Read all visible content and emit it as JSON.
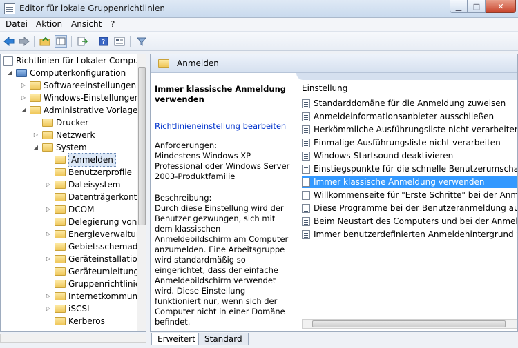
{
  "window": {
    "title": "Editor für lokale Gruppenrichtlinien"
  },
  "menu": [
    "Datei",
    "Aktion",
    "Ansicht",
    "?"
  ],
  "tree": [
    {
      "label": "Richtlinien für Lokaler Computer",
      "level": 0
    },
    {
      "label": "Computerkonfiguration",
      "level": 1
    },
    {
      "label": "Softwareeinstellungen",
      "level": 2
    },
    {
      "label": "Windows-Einstellungen",
      "level": 2
    },
    {
      "label": "Administrative Vorlagen",
      "level": 2
    },
    {
      "label": "Drucker",
      "level": 3
    },
    {
      "label": "Netzwerk",
      "level": 3
    },
    {
      "label": "System",
      "level": 3
    },
    {
      "label": "Anmelden",
      "level": 4
    },
    {
      "label": "Benutzerprofile",
      "level": 4
    },
    {
      "label": "Dateisystem",
      "level": 4
    },
    {
      "label": "Datenträgerkontin",
      "level": 4
    },
    {
      "label": "DCOM",
      "level": 4
    },
    {
      "label": "Delegierung von A",
      "level": 4
    },
    {
      "label": "Energieverwaltung",
      "level": 4
    },
    {
      "label": "Gebietsschemadie",
      "level": 4
    },
    {
      "label": "Geräteinstallation",
      "level": 4
    },
    {
      "label": "Geräteumleitung",
      "level": 4
    },
    {
      "label": "Gruppenrichtlinie",
      "level": 4
    },
    {
      "label": "Internetkommuni",
      "level": 4
    },
    {
      "label": "iSCSI",
      "level": 4
    },
    {
      "label": "Kerberos",
      "level": 4
    }
  ],
  "pane": {
    "title": "Anmelden",
    "desc_title": "Immer klassische Anmeldung verwenden",
    "desc_link": "Richtlinieneinstellung bearbeiten",
    "requirements_label": "Anforderungen:",
    "requirements_text": "Mindestens Windows XP Professional oder Windows Server 2003-Produktfamilie",
    "description_label": "Beschreibung:",
    "description_text": "Durch diese Einstellung wird der Benutzer gezwungen, sich mit dem klassischen Anmeldebildschirm am Computer anzumelden. Eine Arbeitsgruppe wird standardmäßig so eingerichtet, dass der einfache Anmeldebildschirm verwendet wird. Diese Einstellung funktioniert nur, wenn sich der Computer nicht in einer Domäne befindet."
  },
  "list": {
    "header": "Einstellung",
    "items": [
      "Standarddomäne für die Anmeldung zuweisen",
      "Anmeldeinformationsanbieter ausschließen",
      "Herkömmliche Ausführungsliste nicht verarbeiten",
      "Einmalige Ausführungsliste nicht verarbeiten",
      "Windows-Startsound deaktivieren",
      "Einstiegspunkte für die schnelle Benutzerumschaltung a",
      "Immer klassische Anmeldung verwenden",
      "Willkommenseite für \"Erste Schritte\" bei der Anmeldung",
      "Diese Programme bei der Benutzeranmeldung ausführen",
      "Beim Neustart des Computers und bei der Anmeldung im",
      "Immer benutzerdefinierten Anmeldehintergrund verwen"
    ],
    "selected": 6
  },
  "tabs": [
    "Erweitert",
    "Standard"
  ]
}
